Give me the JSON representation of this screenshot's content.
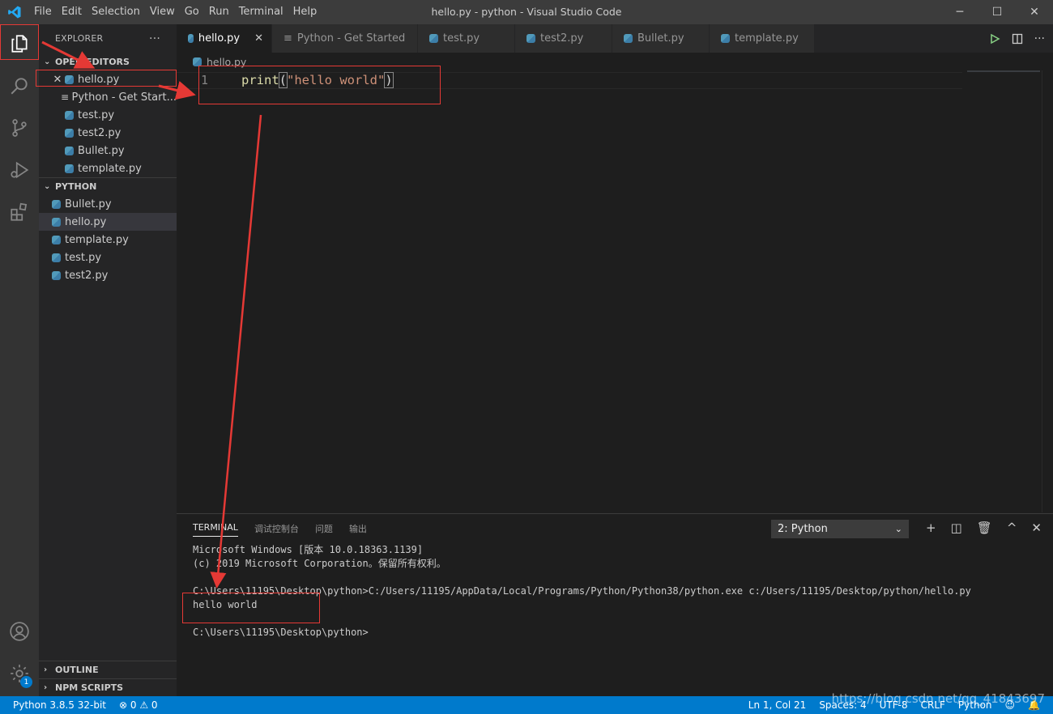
{
  "window": {
    "title": "hello.py - python - Visual Studio Code"
  },
  "menu": [
    "File",
    "Edit",
    "Selection",
    "View",
    "Go",
    "Run",
    "Terminal",
    "Help"
  ],
  "sidebar": {
    "header": "EXPLORER",
    "more": "···",
    "open_editors": {
      "title": "OPEN EDITORS",
      "items": [
        "hello.py",
        "Python - Get Start...",
        "test.py",
        "test2.py",
        "Bullet.py",
        "template.py"
      ]
    },
    "folder": {
      "title": "PYTHON",
      "items": [
        "Bullet.py",
        "hello.py",
        "template.py",
        "test.py",
        "test2.py"
      ]
    },
    "outline": "OUTLINE",
    "npm": "NPM SCRIPTS"
  },
  "tabs": [
    "hello.py",
    "Python - Get Started",
    "test.py",
    "test2.py",
    "Bullet.py",
    "template.py"
  ],
  "breadcrumb": "hello.py",
  "editor": {
    "line_number": "1",
    "code_fn": "print",
    "code_open": "(",
    "code_str": "\"hello world\"",
    "code_close": ")"
  },
  "panel": {
    "tabs": [
      "TERMINAL",
      "调试控制台",
      "问题",
      "输出"
    ],
    "terminal_select": "2: Python",
    "lines": [
      "Microsoft Windows [版本 10.0.18363.1139]",
      "(c) 2019 Microsoft Corporation。保留所有权利。",
      "",
      "C:\\Users\\11195\\Desktop\\python>C:/Users/11195/AppData/Local/Programs/Python/Python38/python.exe c:/Users/11195/Desktop/python/hello.py",
      "hello world",
      "",
      "C:\\Users\\11195\\Desktop\\python>"
    ]
  },
  "statusbar": {
    "interpreter": "Python 3.8.5 32-bit",
    "problems": "⊗ 0 ⚠ 0",
    "position": "Ln 1, Col 21",
    "spaces": "Spaces: 4",
    "encoding": "UTF-8",
    "eol": "CRLF",
    "language": "Python"
  },
  "badge": "1",
  "watermark": "https://blog.csdn.net/qq_41843697",
  "colors": {
    "accent": "#007acc",
    "annotation": "#e53935"
  }
}
